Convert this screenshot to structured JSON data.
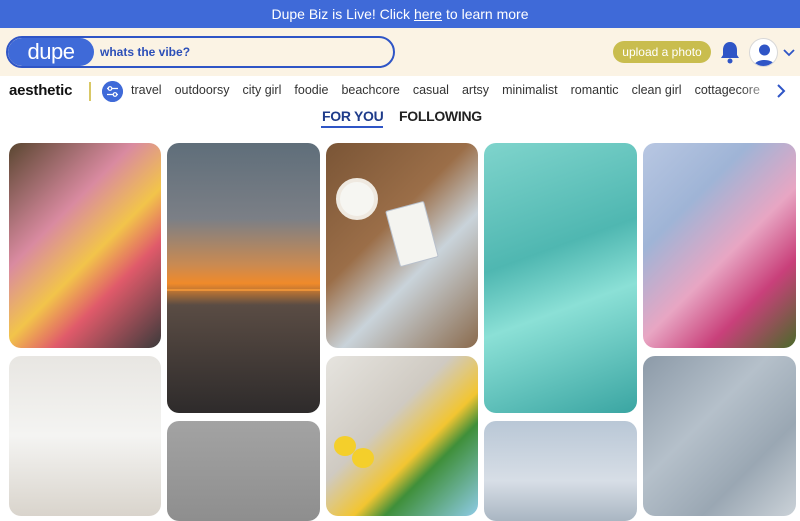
{
  "banner": {
    "text_before": "Dupe Biz is Live! Click",
    "link": "here",
    "text_after": "to learn more"
  },
  "header": {
    "logo": "dupe",
    "search_placeholder": "whats the vibe?",
    "upload_label": "upload a photo",
    "bell_icon": "bell-icon",
    "avatar_icon": "user-avatar-icon",
    "chevron_icon": "chevron-down-icon"
  },
  "categories": {
    "title": "aesthetic",
    "filter_icon": "sliders-icon",
    "items": [
      "travel",
      "outdoorsy",
      "city girl",
      "foodie",
      "beachcore",
      "casual",
      "artsy",
      "minimalist",
      "romantic",
      "clean girl",
      "cottagecore"
    ],
    "next_icon": "chevron-right-icon"
  },
  "feed": {
    "tabs": [
      "FOR YOU",
      "FOLLOWING"
    ],
    "active_tab": "FOR YOU"
  },
  "colors": {
    "brand_blue": "#3f6ad8",
    "cream": "#fbf3e4",
    "upload_yellow": "#c9bd4e"
  }
}
